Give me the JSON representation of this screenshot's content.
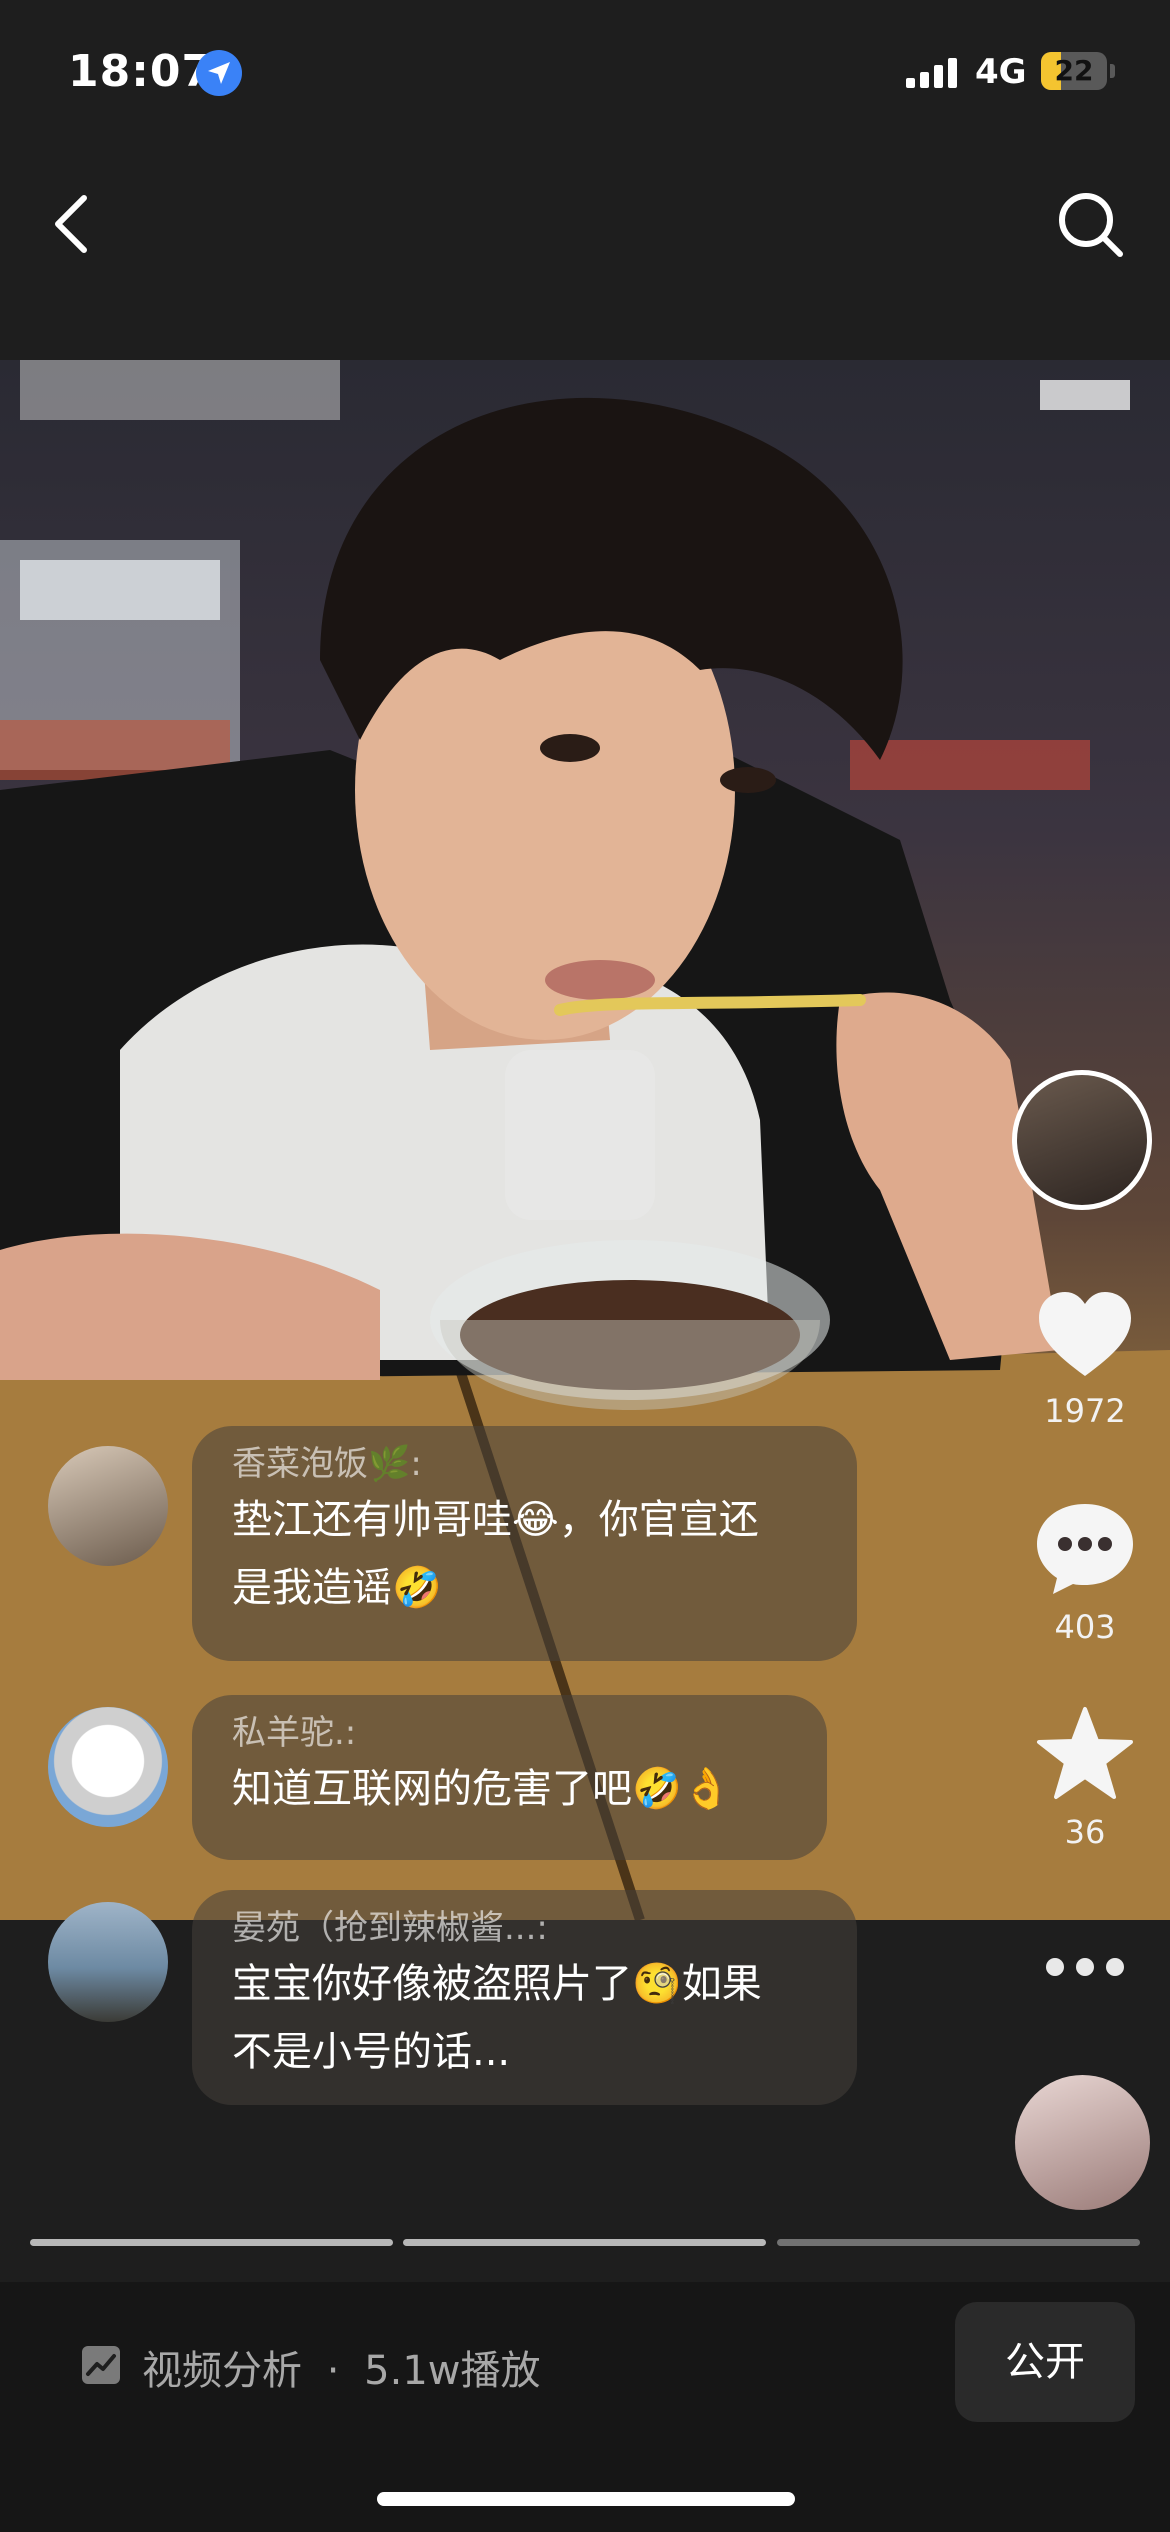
{
  "status_bar": {
    "time": "18:07",
    "network": "4G",
    "battery": "22"
  },
  "video": {
    "creator_avatar": "creator-avatar",
    "actions": {
      "likes": "1972",
      "comments": "403",
      "favorites": "36"
    }
  },
  "comments": [
    {
      "user": "香菜泡饭🌿:",
      "text_lines": [
        "垫江还有帅哥哇😂，你官宣还",
        "是我造谣🤣"
      ]
    },
    {
      "user": "私羊驼.:",
      "text_lines": [
        "知道互联网的危害了吧🤣👌"
      ]
    },
    {
      "user": "晏苑（抢到辣椒酱...:",
      "text_lines": [
        "宝宝你好像被盗照片了🧐如果",
        "不是小号的话..."
      ]
    }
  ],
  "footer": {
    "analysis_label": "视频分析",
    "separator": "·",
    "plays": "5.1w播放",
    "public_button": "公开"
  },
  "progress": {
    "segments": 3,
    "active_segment": 1
  },
  "colors": {
    "background": "#1e1e1e",
    "accent_blue": "#3a82f7",
    "battery_yellow": "#f4c430"
  }
}
